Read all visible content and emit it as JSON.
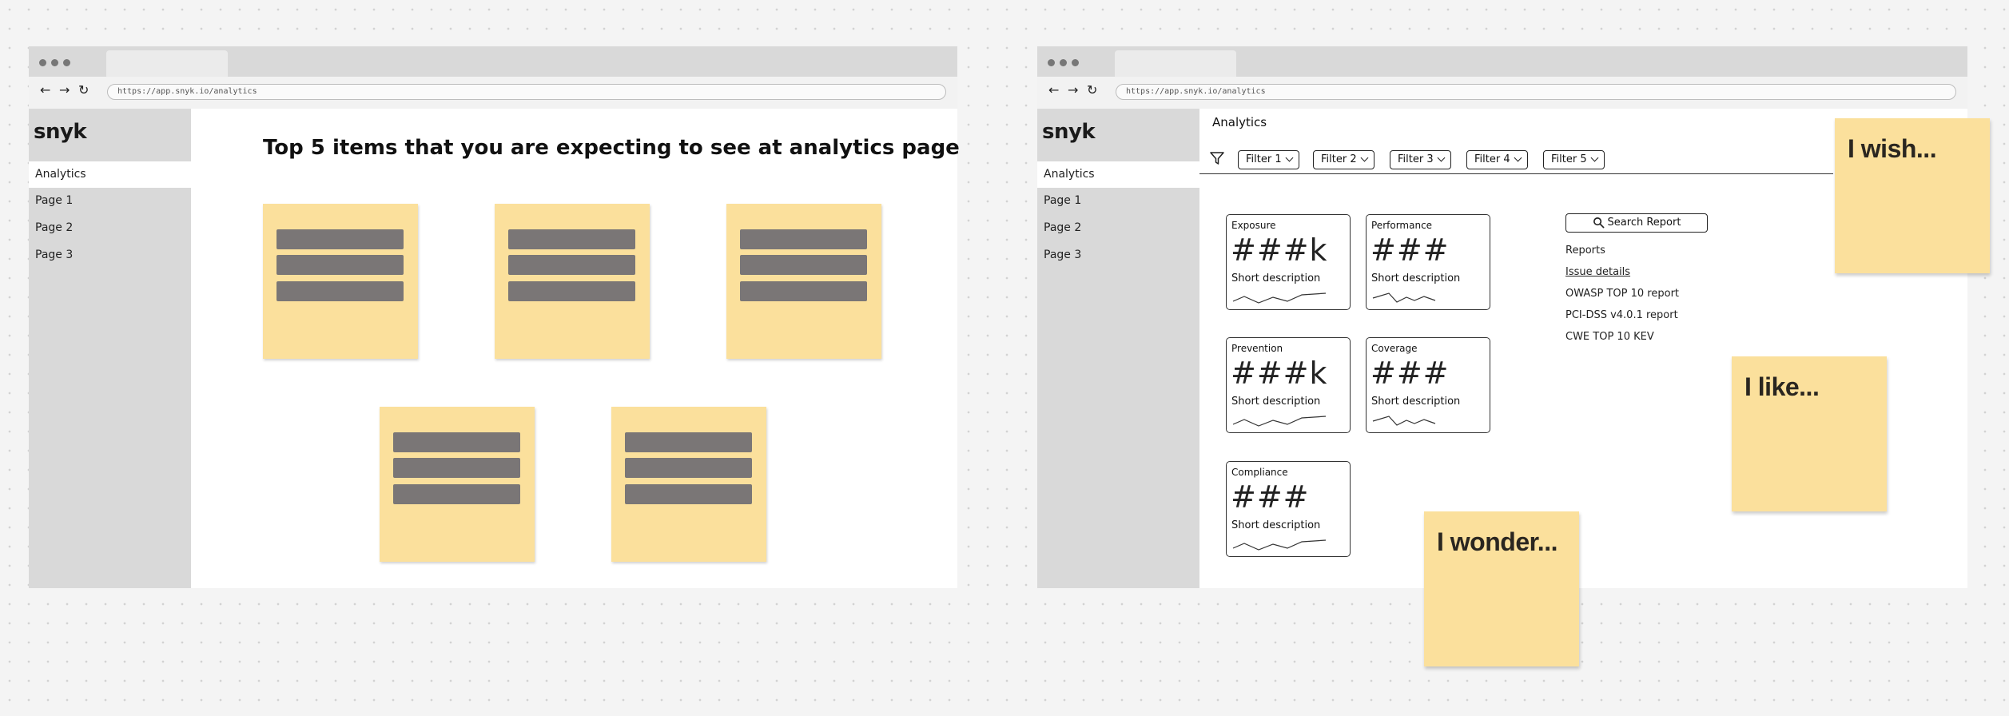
{
  "browser": {
    "url": "https://app.snyk.io/analytics",
    "back_icon": "←",
    "forward_icon": "→",
    "reload_icon": "↻"
  },
  "sidebar": {
    "logo": "snyk",
    "items": [
      {
        "label": "Analytics",
        "active": true
      },
      {
        "label": "Page 1"
      },
      {
        "label": "Page 2"
      },
      {
        "label": "Page 3"
      }
    ]
  },
  "left_panel": {
    "heading": "Top 5 items that you are expecting to see at analytics page",
    "sticky_count": 5
  },
  "right_panel": {
    "title": "Analytics",
    "filters": [
      "Filter 1",
      "Filter 2",
      "Filter 3",
      "Filter 4",
      "Filter 5"
    ],
    "cards": [
      {
        "title": "Exposure",
        "value": "###k",
        "description": "Short description"
      },
      {
        "title": "Performance",
        "value": "###",
        "description": "Short description"
      },
      {
        "title": "Prevention",
        "value": "###k",
        "description": "Short description"
      },
      {
        "title": "Coverage",
        "value": "###",
        "description": "Short description"
      },
      {
        "title": "Compliance",
        "value": "###",
        "description": "Short description"
      }
    ],
    "search_button": "Search Report",
    "reports_label": "Reports",
    "report_links": [
      "Issue details",
      "OWASP TOP 10 report",
      "PCI-DSS v4.0.1 report",
      "CWE TOP 10 KEV"
    ]
  },
  "notes": {
    "wish": "I wish...",
    "like": "I like...",
    "wonder": "I wonder..."
  },
  "colors": {
    "sticky": "#fbe09c",
    "sidebar": "#d9d9d9",
    "placeholder_bar": "#7a7676"
  }
}
